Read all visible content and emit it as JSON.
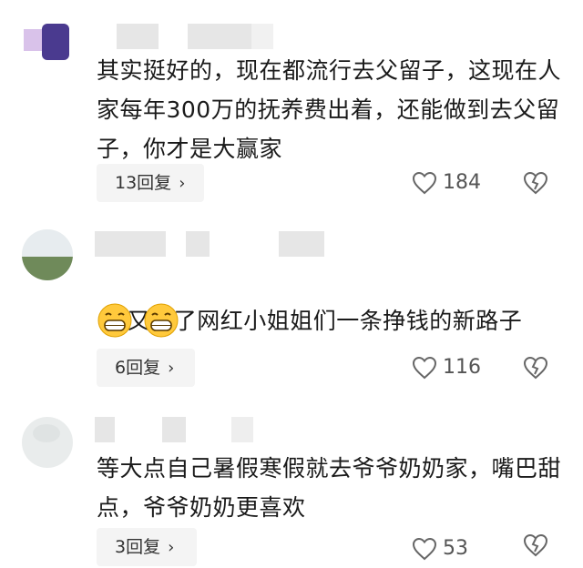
{
  "comments": [
    {
      "content": "其实挺好的，现在都流行去父留子，这现在人家每年300万的抚养费出着，还能做到去父留子，你才是大赢家",
      "replies": "13回复",
      "likes": "184"
    },
    {
      "content": "又给了网红小姐姐们一条挣钱的新路子",
      "emojis": [
        "grin-emoji",
        "grin-emoji"
      ],
      "replies": "6回复",
      "likes": "116"
    },
    {
      "content": "等大点自己暑假寒假就去爷爷奶奶家，嘴巴甜点，爷爷奶奶更喜欢",
      "replies": "3回复",
      "likes": "53"
    }
  ],
  "icons": {
    "reply_chevron": "chevron-right-icon",
    "like": "heart-outline-icon",
    "dislike": "broken-heart-icon"
  },
  "colors": {
    "text": "#1a1a1a",
    "meta": "#555555",
    "pill": "#f4f4f4",
    "redaction": "#e6e6e6"
  }
}
